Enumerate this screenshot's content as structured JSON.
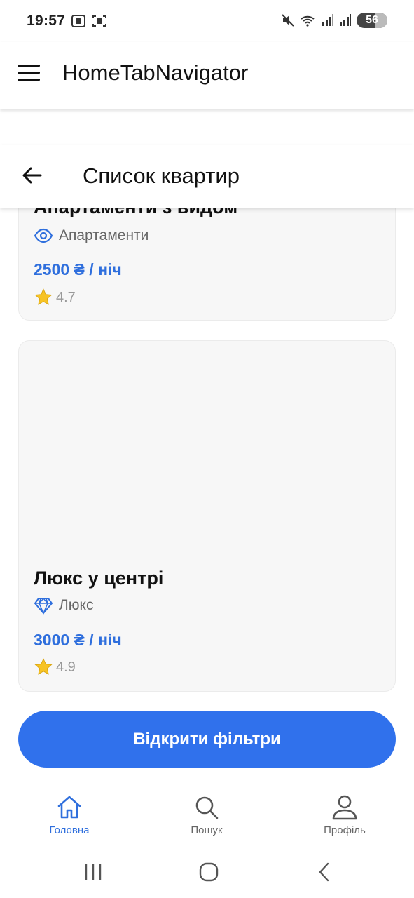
{
  "status_bar": {
    "time": "19:57",
    "battery": "56",
    "battery_level_pct": 56
  },
  "app_header": {
    "title": "HomeTabNavigator",
    "menu_icon": "hamburger-menu-icon"
  },
  "screen_header": {
    "title": "Список квартир",
    "back_icon": "arrow-left-icon"
  },
  "listings": [
    {
      "title": "Апартаменти з видом",
      "type_icon": "eye-icon",
      "type": "Апартаменти",
      "price": "2500 ₴ / ніч",
      "rating_icon": "star-icon",
      "rating": "4.7"
    },
    {
      "title": "Люкс у центрі",
      "type_icon": "diamond-icon",
      "type": "Люкс",
      "price": "3000 ₴ / ніч",
      "rating_icon": "star-icon",
      "rating": "4.9"
    }
  ],
  "filter_button": {
    "label": "Відкрити фільтри"
  },
  "tabs": [
    {
      "label": "Головна",
      "icon": "home-icon",
      "active": true
    },
    {
      "label": "Пошук",
      "icon": "search-icon",
      "active": false
    },
    {
      "label": "Профіль",
      "icon": "profile-icon",
      "active": false
    }
  ],
  "colors": {
    "accent": "#3071ec",
    "price": "#2f6fdd",
    "active_tab": "#2f6fdd",
    "card_bg": "#f7f7f7"
  }
}
